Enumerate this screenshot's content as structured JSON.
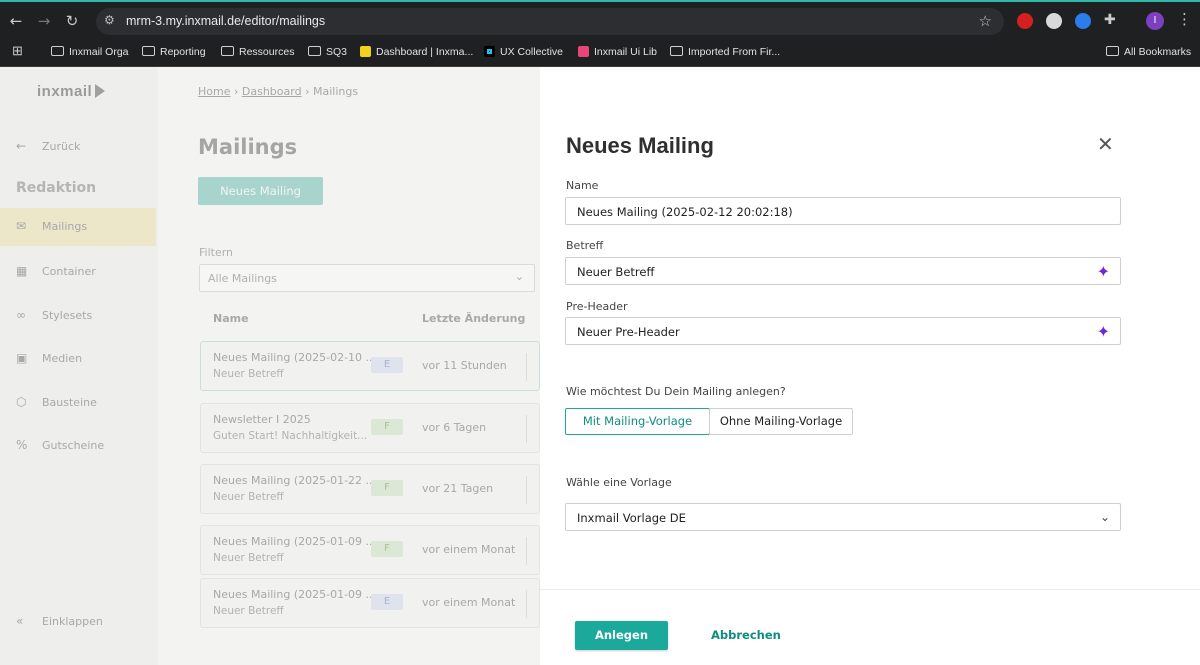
{
  "browser": {
    "url": "mrm-3.my.inxmail.de/editor/mailings",
    "profile_initial": "I",
    "bookmarks": [
      "Inxmail Orga",
      "Reporting",
      "Ressources",
      "SQ3",
      "Dashboard | Inxma...",
      "UX Collective",
      "Inxmail Ui Lib",
      "Imported From Fir..."
    ],
    "all_bookmarks": "All Bookmarks"
  },
  "app": {
    "logo": "inxmail",
    "breadcrumb": {
      "home": "Home",
      "dashboard": "Dashboard",
      "current": "Mailings"
    },
    "sidebar": {
      "back": "Zurück",
      "heading": "Redaktion",
      "items": [
        "Mailings",
        "Container",
        "Stylesets",
        "Medien",
        "Bausteine",
        "Gutscheine"
      ],
      "collapse": "Einklappen"
    },
    "main": {
      "title": "Mailings",
      "new_button": "Neues Mailing",
      "filter_label": "Filtern",
      "filter_value": "Alle Mailings",
      "columns": {
        "name": "Name",
        "last_change": "Letzte Änderung"
      },
      "rows": [
        {
          "name": "Neues Mailing (2025-02-10 ...",
          "subject": "Neuer Betreff",
          "badge": "E",
          "date": "vor 11 Stunden"
        },
        {
          "name": "Newsletter I 2025",
          "subject": "Guten Start! Nachhaltigkeit...",
          "badge": "F",
          "date": "vor 6 Tagen"
        },
        {
          "name": "Neues Mailing (2025-01-22 ...",
          "subject": "Neuer Betreff",
          "badge": "F",
          "date": "vor 21 Tagen"
        },
        {
          "name": "Neues Mailing (2025-01-09 ...",
          "subject": "Neuer Betreff",
          "badge": "F",
          "date": "vor einem Monat"
        },
        {
          "name": "Neues Mailing (2025-01-09 ...",
          "subject": "Neuer Betreff",
          "badge": "E",
          "date": "vor einem Monat"
        }
      ]
    }
  },
  "dialog": {
    "title": "Neues Mailing",
    "name_label": "Name",
    "name_value": "Neues Mailing (2025-02-12 20:02:18)",
    "subject_label": "Betreff",
    "subject_value": "Neuer Betreff",
    "preheader_label": "Pre-Header",
    "preheader_value": "Neuer Pre-Header",
    "question": "Wie möchtest Du Dein Mailing anlegen?",
    "option_with": "Mit Mailing-Vorlage",
    "option_without": "Ohne Mailing-Vorlage",
    "template_label": "Wähle eine Vorlage",
    "template_value": "Inxmail Vorlage DE",
    "submit": "Anlegen",
    "cancel": "Abbrechen"
  },
  "colors": {
    "accent": "#1ba99b",
    "ai_sparkle": "#6a2ad0",
    "badge_e": "#dfe3ee",
    "badge_f": "#dbe8d6"
  }
}
